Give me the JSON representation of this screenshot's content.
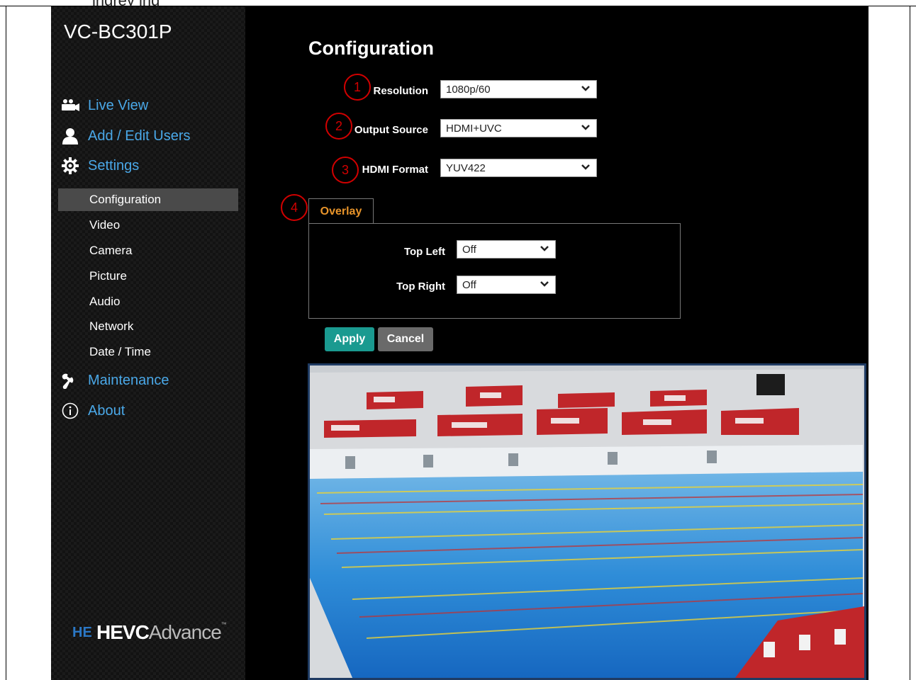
{
  "caption_fragment": "ingrey  ing",
  "device": {
    "name": "VC-BC301P"
  },
  "nav": {
    "live_view": "Live View",
    "users": "Add / Edit Users",
    "settings": "Settings",
    "settings_sub": [
      "Configuration",
      "Video",
      "Camera",
      "Picture",
      "Audio",
      "Network",
      "Date / Time"
    ],
    "maintenance": "Maintenance",
    "about": "About"
  },
  "logo": {
    "mark": "HE",
    "brand": "HEVC",
    "suffix": "Advance",
    "tm": "™"
  },
  "page": {
    "title": "Configuration"
  },
  "form": {
    "resolution": {
      "label": "Resolution",
      "value": "1080p/60"
    },
    "output_source": {
      "label": "Output Source",
      "value": "HDMI+UVC"
    },
    "hdmi_format": {
      "label": "HDMI Format",
      "value": "YUV422"
    }
  },
  "overlay": {
    "tab_label": "Overlay",
    "top_left": {
      "label": "Top Left",
      "value": "Off"
    },
    "top_right": {
      "label": "Top Right",
      "value": "Off"
    }
  },
  "buttons": {
    "apply": "Apply",
    "cancel": "Cancel"
  },
  "callouts": [
    "1",
    "2",
    "3",
    "4"
  ],
  "colors": {
    "accent_blue": "#4aa8e8",
    "tab_orange": "#e8942a",
    "apply_teal": "#1a9a90",
    "callout_red": "#d10000"
  }
}
